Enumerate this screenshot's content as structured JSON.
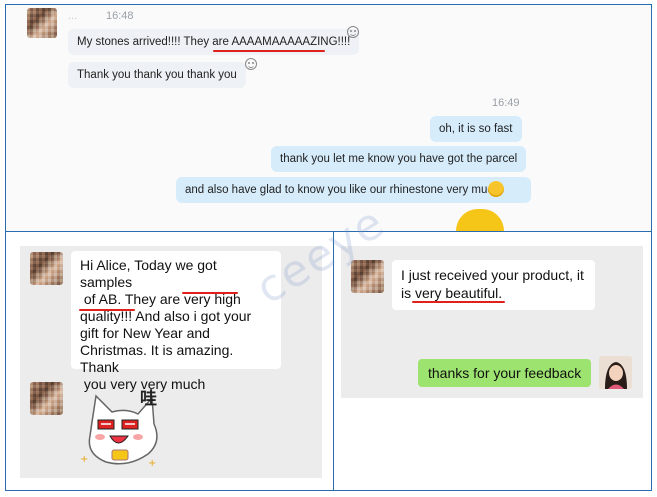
{
  "top_chat": {
    "sender_name": "...",
    "time_1": "16:48",
    "msg_1": "My stones arrived!!!! They are AAAAMAAAAAZING!!!!",
    "msg_2": "Thank you thank you thank you",
    "time_2": "16:49",
    "reply_1": "oh, it is so fast",
    "reply_2": "thank you let me know you have got the parcel",
    "reply_3": "and also have glad to know you like our rhinestone very much."
  },
  "left_chat": {
    "message_lines": [
      "Hi Alice, Today we got samples",
      " of AB. They are very high",
      "quality!!! And also i got your",
      "gift for New Year and",
      "Christmas. It is amazing. Thank",
      " you very very much"
    ],
    "sticker_text": "哇"
  },
  "right_chat": {
    "message_lines": [
      "I just received your product, it",
      "is very beautiful."
    ],
    "reply": "thanks for your feedback"
  },
  "watermark": "ceeye",
  "colors": {
    "frame_border": "#2b6cb0",
    "underline": "#e0201b",
    "reply_bubble": "#d6ecfb",
    "wechat_green": "#9de36f"
  }
}
